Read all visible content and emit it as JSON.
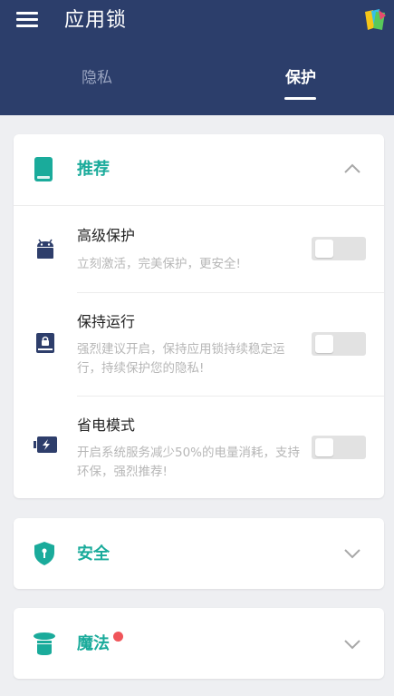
{
  "app": {
    "title": "应用锁"
  },
  "tabs": [
    {
      "label": "隐私",
      "active": false
    },
    {
      "label": "保护",
      "active": true
    }
  ],
  "colors": {
    "header_bg": "#2c3e6b",
    "accent": "#1aab9b",
    "badge": "#f0555a"
  },
  "sections": {
    "recommend": {
      "title": "推荐",
      "icon": "phone-icon",
      "expanded": true,
      "items": [
        {
          "title": "高级保护",
          "desc": "立刻激活，完美保护，更安全!",
          "icon": "android-icon",
          "enabled": false
        },
        {
          "title": "保持运行",
          "desc": "强烈建议开启，保持应用锁持续稳定运行，持续保护您的隐私!",
          "icon": "lock-book-icon",
          "enabled": false
        },
        {
          "title": "省电模式",
          "desc": "开启系统服务减少50%的电量消耗，支持环保，强烈推荐!",
          "icon": "battery-icon",
          "enabled": false
        }
      ]
    },
    "security": {
      "title": "安全",
      "icon": "shield-icon",
      "expanded": false
    },
    "magic": {
      "title": "魔法",
      "icon": "magic-hat-icon",
      "expanded": false,
      "has_badge": true
    }
  }
}
